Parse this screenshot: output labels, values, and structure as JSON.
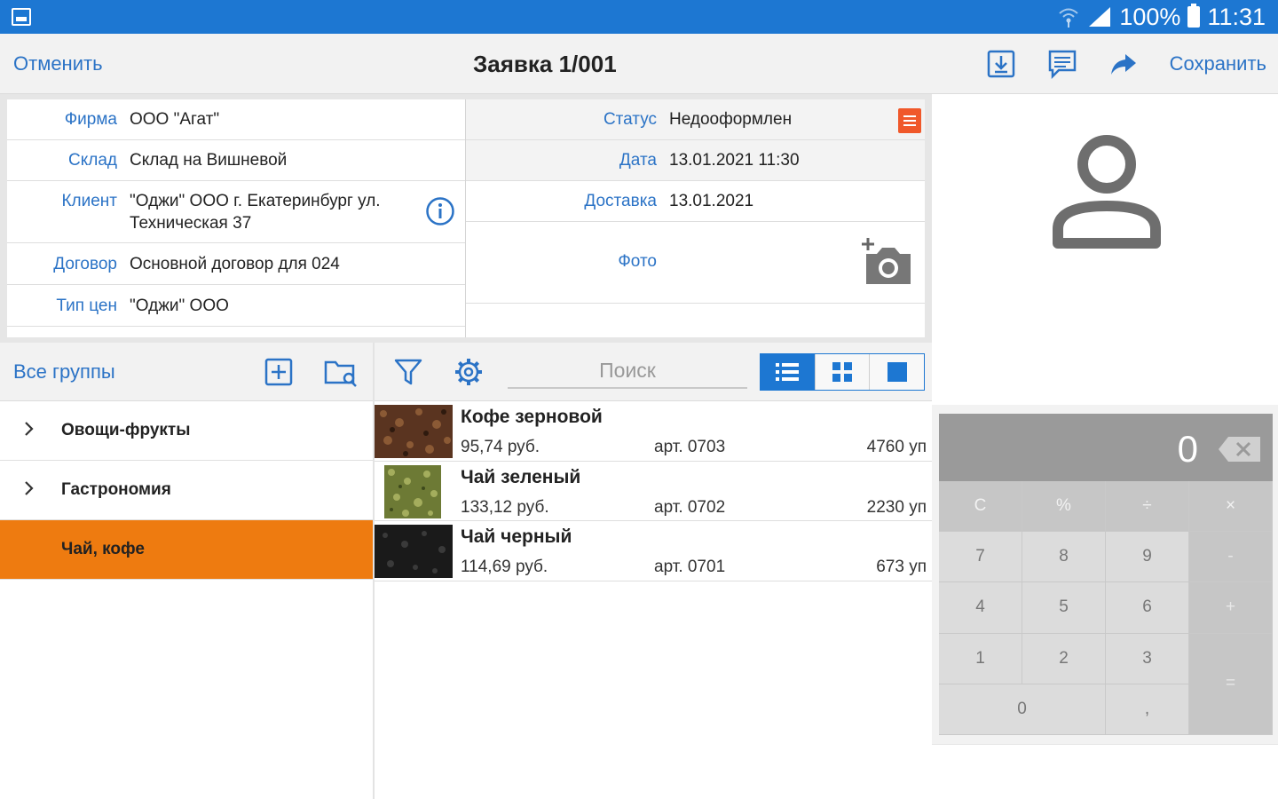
{
  "status_bar": {
    "battery": "100%",
    "time": "11:31"
  },
  "action_bar": {
    "cancel": "Отменить",
    "title": "Заявка 1/001",
    "save": "Сохранить"
  },
  "form": {
    "left": [
      {
        "label": "Фирма",
        "value": "ООО \"Агат\""
      },
      {
        "label": "Склад",
        "value": "Склад на Вишневой"
      },
      {
        "label": "Клиент",
        "value": "\"Оджи\" ООО г. Екатеринбург ул. Техническая 37"
      },
      {
        "label": "Договор",
        "value": "Основной договор для 024"
      },
      {
        "label": "Тип цен",
        "value": "\"Оджи\" ООО"
      }
    ],
    "right": [
      {
        "label": "Статус",
        "value": "Недооформлен"
      },
      {
        "label": "Дата",
        "value": "13.01.2021 11:30"
      },
      {
        "label": "Доставка",
        "value": "13.01.2021"
      },
      {
        "label": "Фото",
        "value": ""
      }
    ]
  },
  "groups": {
    "header": "Все группы",
    "items": [
      {
        "label": "Овощи-фрукты",
        "expandable": true
      },
      {
        "label": "Гастрономия",
        "expandable": true
      },
      {
        "label": "Чай, кофе",
        "expandable": false,
        "active": true
      }
    ]
  },
  "products_toolbar": {
    "search_placeholder": "Поиск"
  },
  "products": [
    {
      "name": "Кофе зерновой",
      "price": "95,74 руб.",
      "article": "арт. 0703",
      "stock": "4760 уп"
    },
    {
      "name": "Чай зеленый",
      "price": "133,12 руб.",
      "article": "арт. 0702",
      "stock": "2230 уп"
    },
    {
      "name": "Чай черный",
      "price": "114,69 руб.",
      "article": "арт. 0701",
      "stock": "673 уп"
    }
  ],
  "keypad": {
    "display": "0",
    "keys": [
      "C",
      "%",
      "÷",
      "×",
      "7",
      "8",
      "9",
      "-",
      "4",
      "5",
      "6",
      "+",
      "1",
      "2",
      "3",
      "=",
      "0",
      ","
    ]
  },
  "colors": {
    "accent": "#1d77d2",
    "link": "#2b73c6",
    "active_group": "#ee7b10",
    "status_badge": "#f0582a"
  }
}
